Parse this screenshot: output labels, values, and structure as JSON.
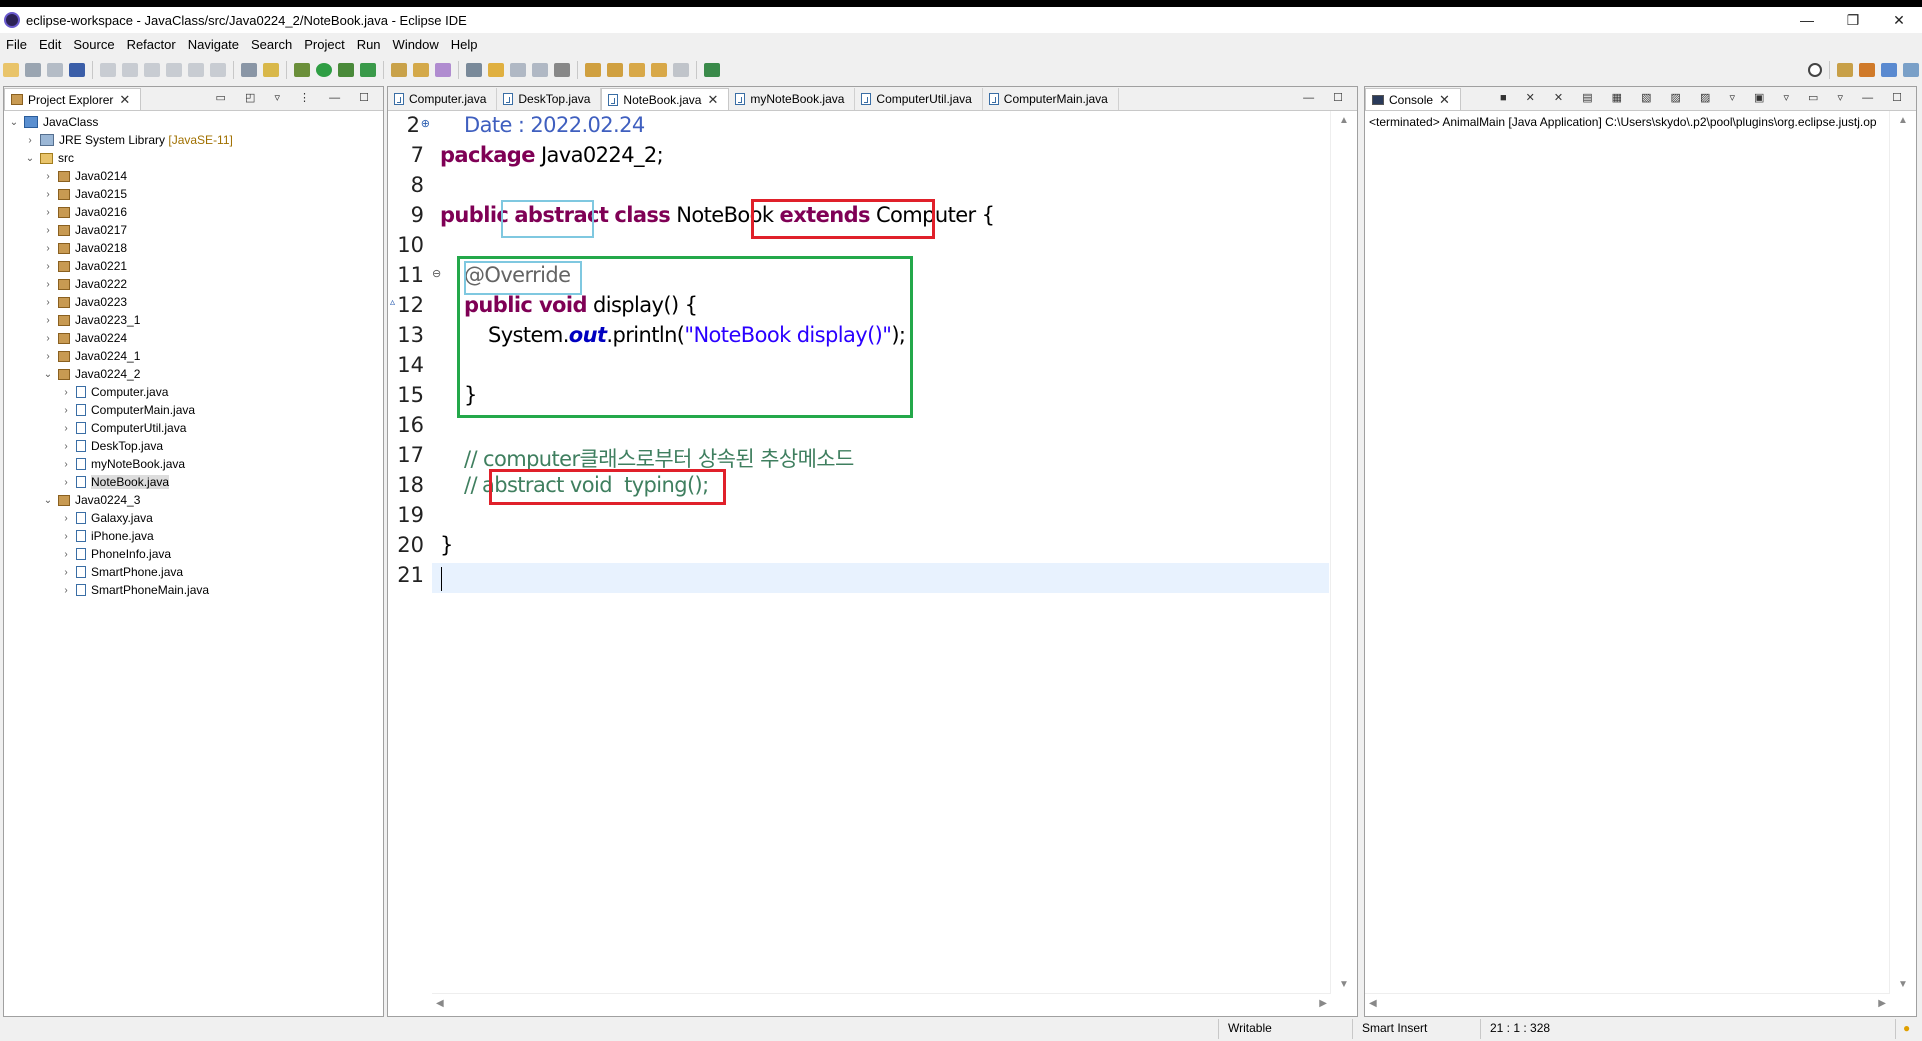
{
  "window": {
    "title": "eclipse-workspace - JavaClass/src/Java0224_2/NoteBook.java - Eclipse IDE",
    "controls": [
      "—",
      "❐",
      "✕"
    ]
  },
  "menu": [
    "File",
    "Edit",
    "Source",
    "Refactor",
    "Navigate",
    "Search",
    "Project",
    "Run",
    "Window",
    "Help"
  ],
  "explorer": {
    "title": "Project Explorer",
    "project": "JavaClass",
    "jre_label": "JRE System Library",
    "jre_version": "[JavaSE-11]",
    "src": "src",
    "packages": [
      "Java0214",
      "Java0215",
      "Java0216",
      "Java0217",
      "Java0218",
      "Java0221",
      "Java0222",
      "Java0223",
      "Java0223_1",
      "Java0224",
      "Java0224_1"
    ],
    "expanded_pkg_1": {
      "name": "Java0224_2",
      "files": [
        "Computer.java",
        "ComputerMain.java",
        "ComputerUtil.java",
        "DeskTop.java",
        "myNoteBook.java",
        "NoteBook.java"
      ]
    },
    "expanded_pkg_2": {
      "name": "Java0224_3",
      "files": [
        "Galaxy.java",
        "iPhone.java",
        "PhoneInfo.java",
        "SmartPhone.java",
        "SmartPhoneMain.java"
      ]
    }
  },
  "editor": {
    "tabs": [
      "Computer.java",
      "DeskTop.java",
      "NoteBook.java",
      "myNoteBook.java",
      "ComputerUtil.java",
      "ComputerMain.java"
    ],
    "active_tab": "NoteBook.java",
    "lines": {
      "n2": "2",
      "l2": "Date : 2022.02.24",
      "n7": "7",
      "l7_kw": "package",
      "l7_rest": " Java0224_2;",
      "n8": "8",
      "n9": "9",
      "l9_kw1": "public",
      "l9_kw2": "abstract",
      "l9_kw3": "class",
      "l9_name": " NoteBook ",
      "l9_kw4": "extends",
      "l9_rest": " Computer",
      "l9_brace": "{",
      "n10": "10",
      "n11": "11",
      "l11": "@Override",
      "n12": "12",
      "l12_kw": "public void",
      "l12_rest": " display() {",
      "n13": "13",
      "l13_a": "System.",
      "l13_field": "out",
      "l13_b": ".println(",
      "l13_str": "\"NoteBook display()\"",
      "l13_c": ");",
      "n14": "14",
      "n15": "15",
      "l15": "}",
      "n16": "16",
      "n17": "17",
      "l17": "// computer클래스로부터 상속된 추상메소드",
      "n18": "18",
      "l18_a": "//",
      "l18_b": "abstract void  typing();",
      "n19": "19",
      "n20": "20",
      "l20": "}",
      "n21": "21"
    },
    "highlight_colors": {
      "red": "#e0202a",
      "cyan": "#7fc8e0",
      "green": "#23a84a"
    }
  },
  "console": {
    "title": "Console",
    "text": "<terminated> AnimalMain [Java Application] C:\\Users\\skydo\\.p2\\pool\\plugins\\org.eclipse.justj.op"
  },
  "status": {
    "writable": "Writable",
    "insert": "Smart Insert",
    "position": "21 : 1 : 328"
  }
}
